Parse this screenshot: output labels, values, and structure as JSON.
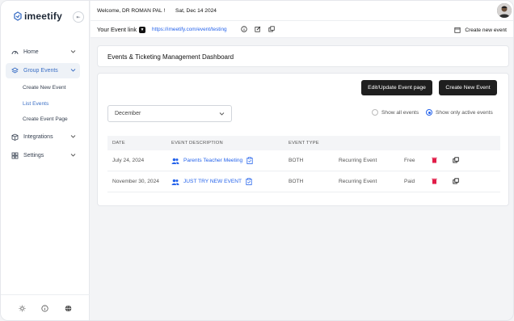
{
  "app": {
    "logo_text": "imeetify"
  },
  "sidebar": {
    "items": [
      {
        "label": "Home",
        "icon": "gauge-icon"
      },
      {
        "label": "Group Events",
        "icon": "layers-icon"
      },
      {
        "label": "Integrations",
        "icon": "box-icon"
      },
      {
        "label": "Settings",
        "icon": "grid-icon"
      }
    ],
    "sub_items": [
      "Create New Event",
      "List Events",
      "Create Event Page"
    ],
    "footer_icons": [
      "sun-icon",
      "info-icon",
      "globe-icon"
    ]
  },
  "header": {
    "welcome": "Welcome, DR ROMAN PAL !",
    "date": "Sat, Dec 14 2024"
  },
  "subbar": {
    "event_link_label": "Your Event link",
    "event_url": "https://imeetify.com/event/testing",
    "create_new_event": "Create new event"
  },
  "page": {
    "title": "Events & Ticketing Management Dashboard",
    "edit_button": "Edit/Update Event page",
    "create_button": "Create New Event",
    "month_select": "December",
    "radio_all": "Show all events",
    "radio_active": "Show only active events"
  },
  "table": {
    "headers": [
      "DATE",
      "EVENT DESCRIPTION",
      "EVENT TYPE"
    ],
    "rows": [
      {
        "date": "July 24, 2024",
        "description": "Parents Teacher Meeting",
        "type": "BOTH",
        "recurrence": "Recurring Event",
        "price": "Free"
      },
      {
        "date": "November 30, 2024",
        "description": "JUST TRY NEW EVENT",
        "type": "BOTH",
        "recurrence": "Recurring Event",
        "price": "Paid"
      }
    ]
  },
  "colors": {
    "accent": "#2563eb",
    "active_nav_bg": "#eef2f7",
    "dark_button": "#1f1f1f",
    "delete": "#e11d48"
  }
}
